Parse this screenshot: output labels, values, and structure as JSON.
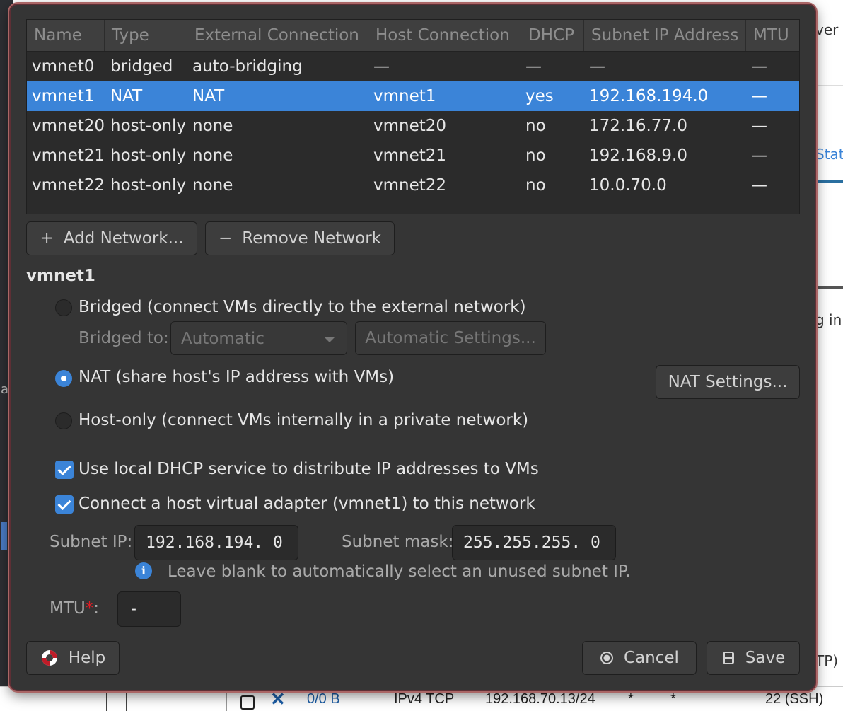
{
  "background": {
    "left_fragment": "a",
    "right_fragments": [
      "ver",
      "Stat",
      "g in"
    ],
    "right_bottom": "TP)",
    "bottom_row": {
      "size": "0/0 B",
      "protocol": "IPv4 TCP",
      "address": "192.168.70.13/24",
      "star1": "*",
      "star2": "*",
      "port": "22 (SSH)"
    }
  },
  "table": {
    "columns": [
      "Name",
      "Type",
      "External Connection",
      "Host Connection",
      "DHCP",
      "Subnet IP Address",
      "MTU"
    ],
    "rows": [
      {
        "name": "vmnet0",
        "type": "bridged",
        "external": "auto-bridging",
        "host": "—",
        "dhcp": "—",
        "subnet": "—",
        "mtu": "—"
      },
      {
        "name": "vmnet1",
        "type": "NAT",
        "external": "NAT",
        "host": "vmnet1",
        "dhcp": "yes",
        "subnet": "192.168.194.0",
        "mtu": "—"
      },
      {
        "name": "vmnet20",
        "type": "host-only",
        "external": "none",
        "host": "vmnet20",
        "dhcp": "no",
        "subnet": "172.16.77.0",
        "mtu": "—"
      },
      {
        "name": "vmnet21",
        "type": "host-only",
        "external": "none",
        "host": "vmnet21",
        "dhcp": "no",
        "subnet": "192.168.9.0",
        "mtu": "—"
      },
      {
        "name": "vmnet22",
        "type": "host-only",
        "external": "none",
        "host": "vmnet22",
        "dhcp": "no",
        "subnet": "10.0.70.0",
        "mtu": "—"
      }
    ],
    "selected_index": 1
  },
  "actions": {
    "add_icon": "+",
    "add_label": "Add Network...",
    "remove_icon": "−",
    "remove_label": "Remove Network"
  },
  "settings": {
    "title": "vmnet1",
    "bridged_label": "Bridged (connect VMs directly to the external network)",
    "bridged_to_label": "Bridged to:",
    "bridged_to_value": "Automatic",
    "automatic_settings_label": "Automatic Settings...",
    "nat_label": "NAT (share host's IP address with VMs)",
    "nat_settings_label": "NAT Settings...",
    "hostonly_label": "Host-only (connect VMs internally in a private network)",
    "dhcp_label": "Use local DHCP service to distribute IP addresses to VMs",
    "dhcp_checked": true,
    "adapter_label": "Connect a host virtual adapter (vmnet1) to this network",
    "adapter_checked": true,
    "subnet_ip_label": "Subnet IP:",
    "subnet_ip_value": "192.168.194. 0",
    "subnet_mask_label": "Subnet mask:",
    "subnet_mask_value": "255.255.255. 0",
    "info_text": "Leave blank to automatically select an unused subnet IP.",
    "mtu_label": "MTU",
    "mtu_required": "*",
    "mtu_colon": ":",
    "mtu_value": "-",
    "selected_mode": "nat"
  },
  "footer": {
    "help_label": "Help",
    "cancel_label": "Cancel",
    "save_label": "Save"
  },
  "colors": {
    "accent": "#3b84d8",
    "dialog_bg": "#353535",
    "required": "#e01b24"
  }
}
